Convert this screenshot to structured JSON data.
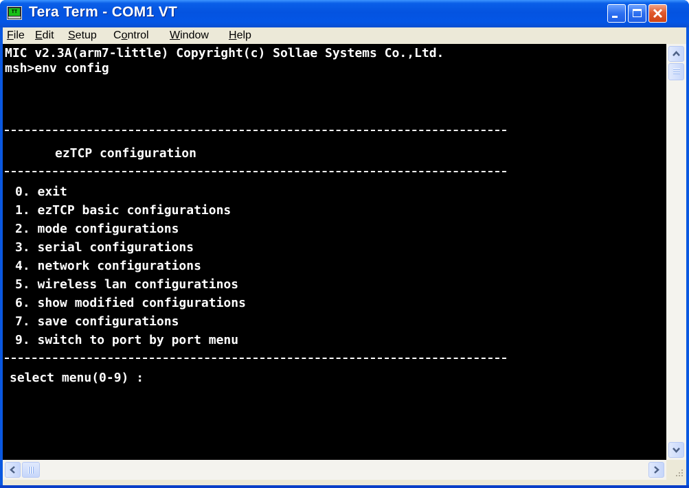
{
  "window": {
    "title": "Tera Term - COM1 VT",
    "icon": "teraterm-app-icon",
    "icon_text": "TT"
  },
  "menu": {
    "items": [
      {
        "accel": "F",
        "rest": "ile"
      },
      {
        "accel": "E",
        "rest": "dit"
      },
      {
        "accel": "S",
        "rest": "etup"
      },
      {
        "pre": "C",
        "accel": "o",
        "rest": "ntrol"
      },
      {
        "accel": "W",
        "rest": "indow"
      },
      {
        "accel": "H",
        "rest": "elp"
      }
    ]
  },
  "terminal": {
    "banner": "MIC v2.3A(arm7-little) Copyright(c) Sollae Systems Co.,Ltd.",
    "command": "msh>env config",
    "heading": "ezTCP configuration",
    "options": [
      "0. exit",
      "1. ezTCP basic configurations",
      "2. mode configurations",
      "3. serial configurations",
      "4. network configurations",
      "5. wireless lan configuratinos",
      "6. show modified configurations",
      "7. save configurations",
      "9. switch to port by port menu"
    ],
    "prompt": "select menu(0-9) :"
  },
  "colors": {
    "titlebar": "#0453e0",
    "terminal_bg": "#000000",
    "terminal_fg": "#ffffff",
    "chrome": "#ece9d8",
    "close_button": "#e15a2e"
  }
}
